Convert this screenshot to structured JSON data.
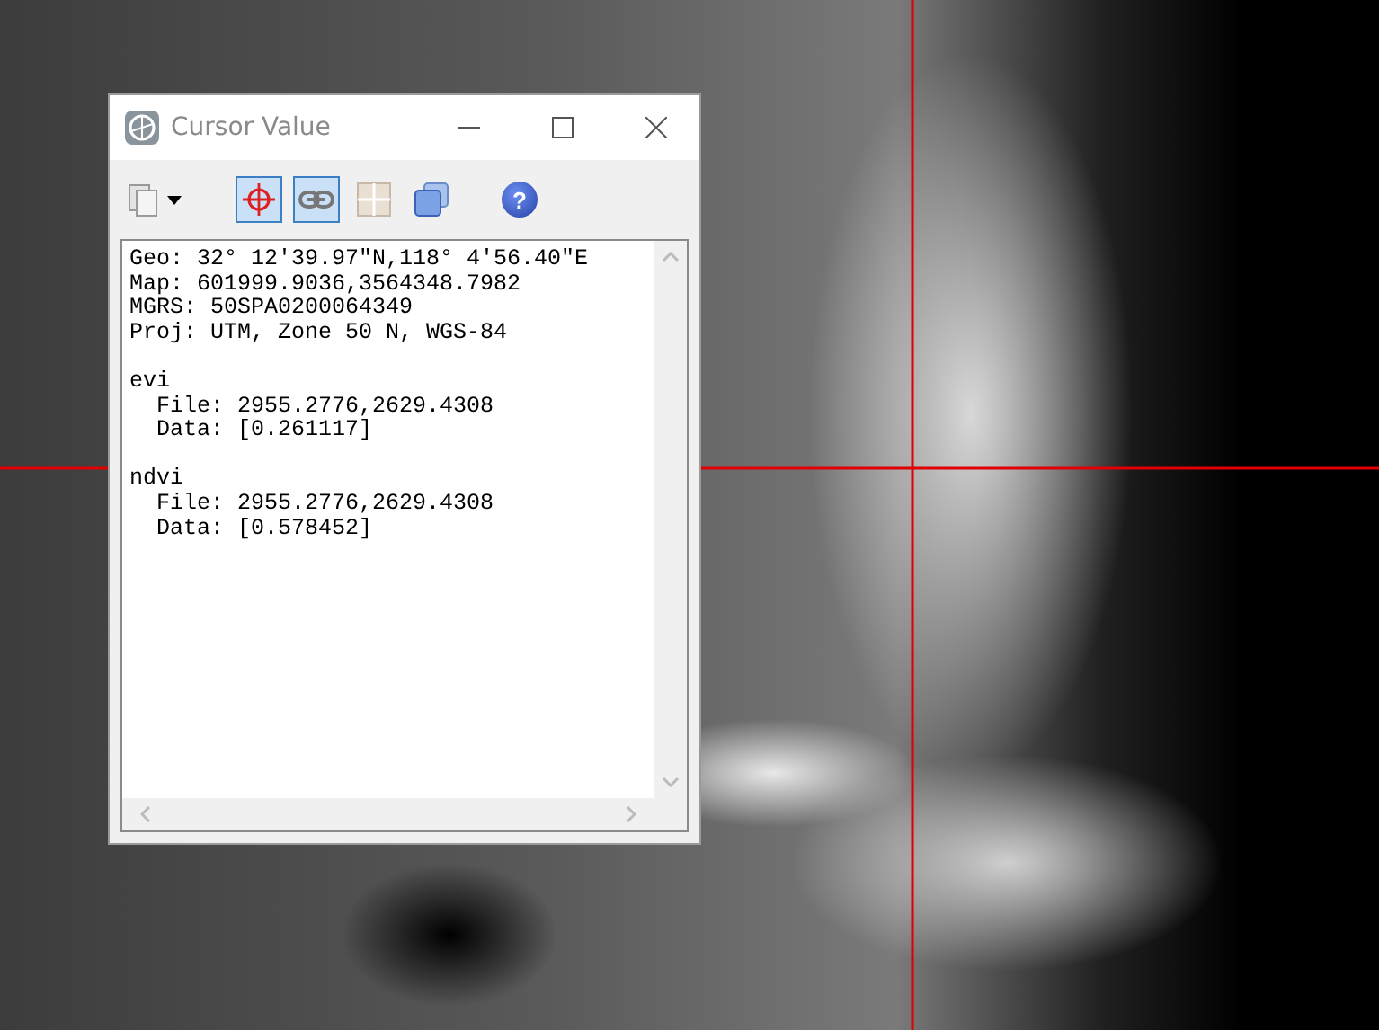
{
  "window": {
    "title": "Cursor Value"
  },
  "toolbar": [
    {
      "kind": "copy",
      "pressed": false
    },
    {
      "kind": "crosshair",
      "pressed": true
    },
    {
      "kind": "link",
      "pressed": true
    },
    {
      "kind": "grid",
      "pressed": false
    },
    {
      "kind": "windows",
      "pressed": false
    },
    {
      "kind": "help",
      "pressed": false,
      "label": "?"
    }
  ],
  "sections": [
    {
      "lines": [
        "Geo: 32° 12′39.97″N,118° 4′56.40″E",
        "Map: 601999.9036,3564348.7982",
        "MGRS: 50SPA0200064349",
        "Proj: UTM, Zone 50 N, WGS-84"
      ]
    },
    {
      "lines": [
        "evi",
        "  File: 2955.2776,2629.4308",
        "  Data: [0.261117]"
      ]
    },
    {
      "lines": [
        "ndvi",
        "  File: 2955.2776,2629.4308",
        "  Data: [0.578452]"
      ]
    }
  ]
}
